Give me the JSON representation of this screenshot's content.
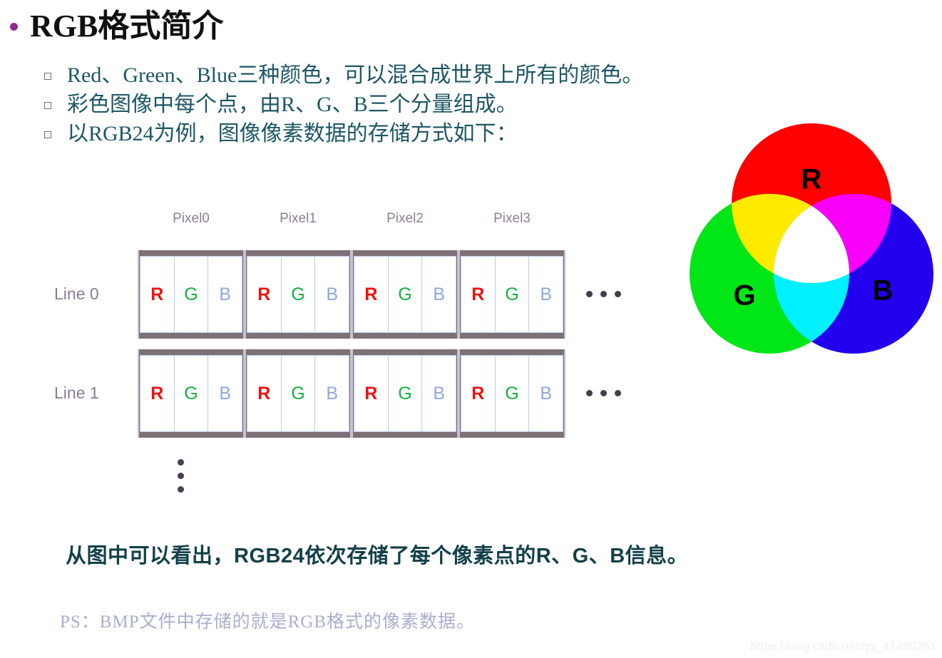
{
  "slide": {
    "title": "RGB格式简介",
    "bullet_marker": "filled-circle",
    "accent_purple": "#8B2C8F",
    "body_text_color": "#1d5763"
  },
  "sub_bullets": [
    {
      "text": "Red、Green、Blue三种颜色，可以混合成世界上所有的颜色。"
    },
    {
      "text": "彩色图像中每个点，由R、G、B三个分量组成。"
    },
    {
      "text": "以RGB24为例，图像像素数据的存储方式如下："
    }
  ],
  "diagram": {
    "pixel_labels": [
      "Pixel0",
      "Pixel1",
      "Pixel2",
      "Pixel3"
    ],
    "row_labels": [
      "Line 0",
      "Line 1"
    ],
    "channels": [
      "R",
      "G",
      "B"
    ],
    "channel_colors": {
      "R": "#ee1111",
      "G": "#12b13f",
      "B": "#8fa8dd"
    },
    "rows": [
      {
        "label": "Line 0",
        "pixels": [
          {
            "name": "Pixel0",
            "cells": [
              "R",
              "G",
              "B"
            ]
          },
          {
            "name": "Pixel1",
            "cells": [
              "R",
              "G",
              "B"
            ]
          },
          {
            "name": "Pixel2",
            "cells": [
              "R",
              "G",
              "B"
            ]
          },
          {
            "name": "Pixel3",
            "cells": [
              "R",
              "G",
              "B"
            ]
          }
        ],
        "trailing": "..."
      },
      {
        "label": "Line 1",
        "pixels": [
          {
            "name": "Pixel0",
            "cells": [
              "R",
              "G",
              "B"
            ]
          },
          {
            "name": "Pixel1",
            "cells": [
              "R",
              "G",
              "B"
            ]
          },
          {
            "name": "Pixel2",
            "cells": [
              "R",
              "G",
              "B"
            ]
          },
          {
            "name": "Pixel3",
            "cells": [
              "R",
              "G",
              "B"
            ]
          }
        ],
        "trailing": "..."
      }
    ],
    "vertical_continuation": "⋮"
  },
  "venn": {
    "labels": {
      "red": "R",
      "green": "G",
      "blue": "B"
    },
    "colors": {
      "red": "#ff0000",
      "green": "#00e617",
      "blue": "#2200ee",
      "yellow": "#ffeb00",
      "magenta": "#f800f8",
      "cyan": "#00f0ff",
      "white": "#ffffff"
    }
  },
  "summary": "从图中可以看出，RGB24依次存储了每个像素点的R、G、B信息。",
  "ps_note": "PS：BMP文件中存储的就是RGB格式的像素数据。",
  "watermark": "https://blog.csdn.net/qq_41498261"
}
